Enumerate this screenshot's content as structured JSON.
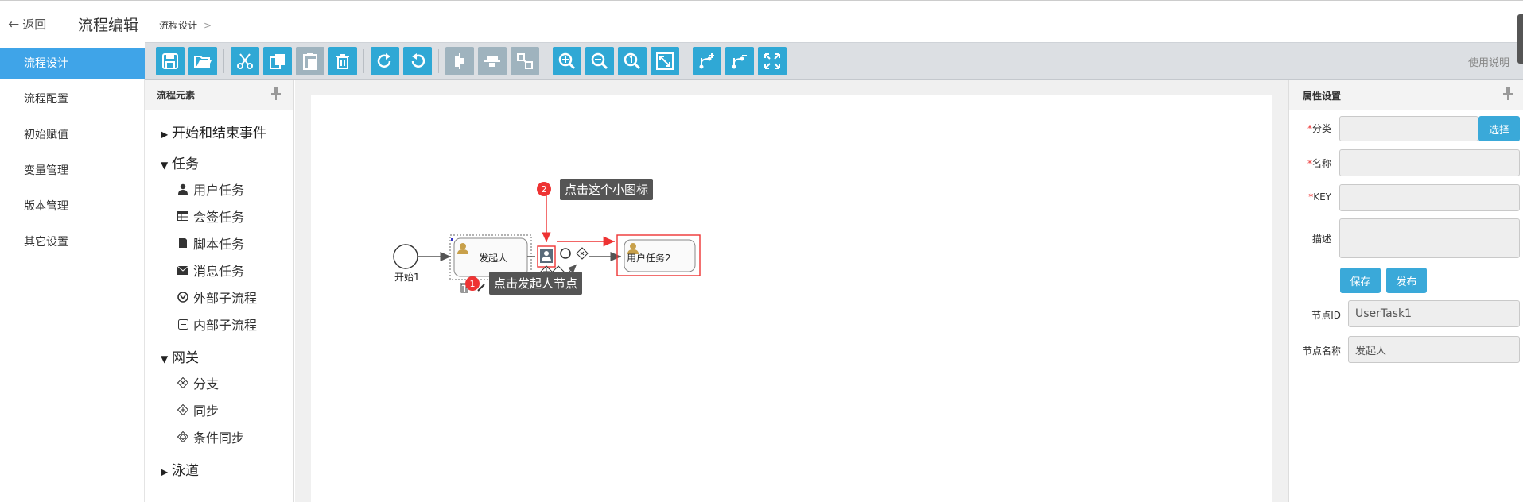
{
  "header": {
    "back_label": "返回",
    "title": "流程编辑"
  },
  "nav": {
    "items": [
      {
        "label": "流程设计"
      },
      {
        "label": "流程配置"
      },
      {
        "label": "初始赋值"
      },
      {
        "label": "变量管理"
      },
      {
        "label": "版本管理"
      },
      {
        "label": "其它设置"
      }
    ]
  },
  "breadcrumb": {
    "current": "流程设计",
    "separator": ">"
  },
  "toolbar": {
    "icons": [
      "save-icon",
      "open-folder-icon",
      "cut-icon",
      "copy-icon",
      "paste-icon",
      "delete-icon",
      "redo-icon",
      "undo-icon",
      "align-vertical-icon",
      "align-horizontal-icon",
      "same-size-icon",
      "zoom-in-icon",
      "zoom-out-icon",
      "zoom-actual-icon",
      "fit-window-icon",
      "add-branch-icon",
      "remove-branch-icon",
      "fullscreen-icon"
    ],
    "help_label": "使用说明",
    "button_color": "#2fa8d5"
  },
  "palette": {
    "title": "流程元素",
    "groups": [
      {
        "label": "开始和结束事件",
        "expanded": false
      },
      {
        "label": "任务",
        "expanded": true,
        "items": [
          "用户任务",
          "会签任务",
          "脚本任务",
          "消息任务",
          "外部子流程",
          "内部子流程"
        ]
      },
      {
        "label": "网关",
        "expanded": true,
        "items": [
          "分支",
          "同步",
          "条件同步"
        ]
      },
      {
        "label": "泳道",
        "expanded": false
      }
    ]
  },
  "diagram": {
    "start_label": "开始1",
    "task1_label": "发起人",
    "task2_label": "用户任务2",
    "tip1": {
      "number": "1",
      "text": "点击发起人节点"
    },
    "tip2": {
      "number": "2",
      "text": "点击这个小图标"
    },
    "highlight_color": "#e33"
  },
  "properties": {
    "title": "属性设置",
    "category": {
      "required_mark": "*",
      "label": "分类",
      "value": "",
      "select_label": "选择"
    },
    "name": {
      "required_mark": "*",
      "label": "名称",
      "value": ""
    },
    "key": {
      "required_mark": "*",
      "label": "KEY",
      "value": ""
    },
    "description": {
      "label": "描述",
      "value": ""
    },
    "save_label": "保存",
    "publish_label": "发布",
    "node_id": {
      "label": "节点ID",
      "value": "UserTask1"
    },
    "node_name": {
      "label": "节点名称",
      "value": "发起人"
    }
  }
}
